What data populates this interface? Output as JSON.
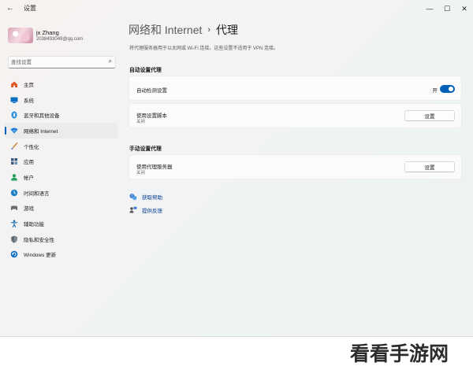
{
  "window": {
    "title": "设置",
    "back_glyph": "←",
    "minimize_glyph": "—",
    "maximize_glyph": "☐",
    "close_glyph": "✕"
  },
  "profile": {
    "name": "jx Zhang",
    "email": "2038493049@qq.com"
  },
  "search": {
    "placeholder": "查找设置",
    "icon": "search-icon"
  },
  "sidebar": {
    "items": [
      {
        "label": "主页",
        "icon": "home-icon",
        "color": "#d13438",
        "active": false
      },
      {
        "label": "系统",
        "icon": "system-icon",
        "color": "#0067c0",
        "active": false
      },
      {
        "label": "蓝牙和其他设备",
        "icon": "bluetooth-icon",
        "color": "#0078d4",
        "active": false
      },
      {
        "label": "网络和 Internet",
        "icon": "network-icon",
        "color": "#0078d4",
        "active": true
      },
      {
        "label": "个性化",
        "icon": "personalization-icon",
        "color": "#c0733a",
        "active": false
      },
      {
        "label": "应用",
        "icon": "apps-icon",
        "color": "#3a5a7a",
        "active": false
      },
      {
        "label": "帐户",
        "icon": "accounts-icon",
        "color": "#2a9d5a",
        "active": false
      },
      {
        "label": "时间和语言",
        "icon": "time-language-icon",
        "color": "#1d7fc4",
        "active": false
      },
      {
        "label": "游戏",
        "icon": "gaming-icon",
        "color": "#6b6b6b",
        "active": false
      },
      {
        "label": "辅助功能",
        "icon": "accessibility-icon",
        "color": "#1f6fb2",
        "active": false
      },
      {
        "label": "隐私和安全性",
        "icon": "privacy-icon",
        "color": "#5f6b75",
        "active": false
      },
      {
        "label": "Windows 更新",
        "icon": "windows-update-icon",
        "color": "#0067c0",
        "active": false
      }
    ]
  },
  "main": {
    "breadcrumb_parent": "网络和 Internet",
    "breadcrumb_separator": "›",
    "breadcrumb_current": "代理",
    "description": "将代理服务器用于以太网或 Wi-Fi 连接。这些设置不适用于 VPN 连接。",
    "auto_section": {
      "title": "自动设置代理",
      "auto_detect_label": "自动检测设置",
      "auto_detect_state": "开",
      "auto_detect_on": true,
      "script_label": "使用设置脚本",
      "script_state": "关闭",
      "script_button": "设置"
    },
    "manual_section": {
      "title": "手动设置代理",
      "proxy_label": "使用代理服务器",
      "proxy_state": "关闭",
      "proxy_button": "设置"
    },
    "links": {
      "help": "获取帮助",
      "feedback": "提供反馈"
    }
  },
  "watermark": "看看手游网"
}
